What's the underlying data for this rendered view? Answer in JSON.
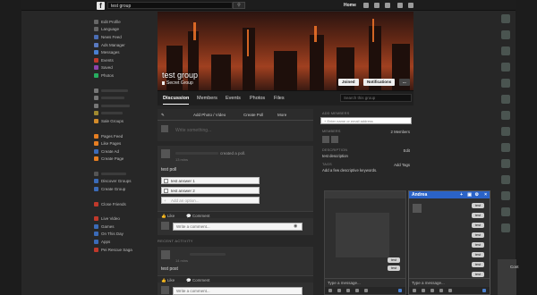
{
  "topbar": {
    "logo": "f",
    "search_value": "test group",
    "home_label": "Home"
  },
  "sidebar": {
    "items": [
      {
        "label": "Edit Profile",
        "icon": "pencil-icon",
        "color": "#666"
      },
      {
        "label": "Language",
        "icon": "globe-icon",
        "color": "#666"
      },
      {
        "label": "News Feed",
        "icon": "newsfeed-icon",
        "color": "#4a6db5"
      },
      {
        "label": "Ads Manager",
        "icon": "ads-icon",
        "color": "#5a7ac0"
      },
      {
        "label": "Messages",
        "icon": "messages-icon",
        "color": "#4a80d0"
      },
      {
        "label": "Events",
        "icon": "events-icon",
        "color": "#c0392b"
      },
      {
        "label": "Saved",
        "icon": "saved-icon",
        "color": "#8e44ad"
      },
      {
        "label": "Photos",
        "icon": "photos-icon",
        "color": "#27ae60"
      }
    ],
    "group_items": [
      {
        "label": "Sale Groups",
        "icon": "sale-groups-icon",
        "color": "#d38b2a"
      }
    ],
    "pages_items": [
      {
        "label": "Pages Feed",
        "icon": "pages-feed-icon",
        "color": "#e67e22"
      },
      {
        "label": "Like Pages",
        "icon": "like-pages-icon",
        "color": "#e67e22"
      },
      {
        "label": "Create Ad",
        "icon": "create-ad-icon",
        "color": "#3b6bb8"
      },
      {
        "label": "Create Page",
        "icon": "create-page-icon",
        "color": "#e67e22"
      }
    ],
    "groups_items": [
      {
        "label": "Discover Groups",
        "icon": "discover-groups-icon",
        "color": "#3b6bb8"
      },
      {
        "label": "Create Group",
        "icon": "create-group-icon",
        "color": "#3b6bb8"
      }
    ],
    "friends_items": [
      {
        "label": "Close Friends",
        "icon": "close-friends-icon",
        "color": "#c0392b"
      }
    ],
    "apps_items": [
      {
        "label": "Live Video",
        "icon": "live-video-icon",
        "color": "#c0392b"
      },
      {
        "label": "Games",
        "icon": "games-icon",
        "color": "#3b6bb8"
      },
      {
        "label": "On This Day",
        "icon": "on-this-day-icon",
        "color": "#3b6bb8"
      },
      {
        "label": "Apps",
        "icon": "apps-icon",
        "color": "#3b6bb8"
      },
      {
        "label": "Pei Rescue Saga",
        "icon": "game-icon",
        "color": "#c0392b"
      }
    ]
  },
  "group": {
    "title": "test group",
    "privacy": "Secret Group",
    "joined_label": "Joined",
    "notifications_label": "Notifications",
    "more_label": "..."
  },
  "tabs": [
    "Discussion",
    "Members",
    "Events",
    "Photos",
    "Files"
  ],
  "search_group_placeholder": "Search this group",
  "composer": {
    "tabs": [
      "Add Photo / Video",
      "Create Poll",
      "More"
    ],
    "placeholder": "Write something..."
  },
  "post1": {
    "action": "created a poll.",
    "time": "13 mins",
    "text": "test poll",
    "options": [
      "test answer 1",
      "test answer 2"
    ],
    "add_option_placeholder": "Add an option...",
    "like_label": "Like",
    "comment_label": "Comment",
    "comment_placeholder": "Write a comment..."
  },
  "recent_activity_label": "RECENT ACTIVITY",
  "post2": {
    "time": "14 mins",
    "text": "test post",
    "like_label": "Like",
    "comment_label": "Comment",
    "comment_placeholder": "Write a comment..."
  },
  "right_col": {
    "add_members_label": "ADD MEMBERS",
    "add_members_placeholder": "+ Enter name or email address",
    "members_label": "MEMBERS",
    "members_count": "2 Members",
    "description_label": "DESCRIPTION",
    "edit_label": "Edit",
    "description_text": "test description",
    "tags_label": "TAGS",
    "add_tags_label": "Add Tags",
    "tags_hint": "Add a few descriptive keywords."
  },
  "chat_main": {
    "name": "Andrea",
    "messages": [
      "test",
      "test",
      "test",
      "test",
      "test",
      "test",
      "test",
      "test"
    ],
    "input_placeholder": "Type a message..."
  },
  "chat_second": {
    "messages": [
      "test",
      "test"
    ],
    "input_placeholder": "Type a message..."
  },
  "right_rail": {
    "mini_label": "Cont"
  }
}
